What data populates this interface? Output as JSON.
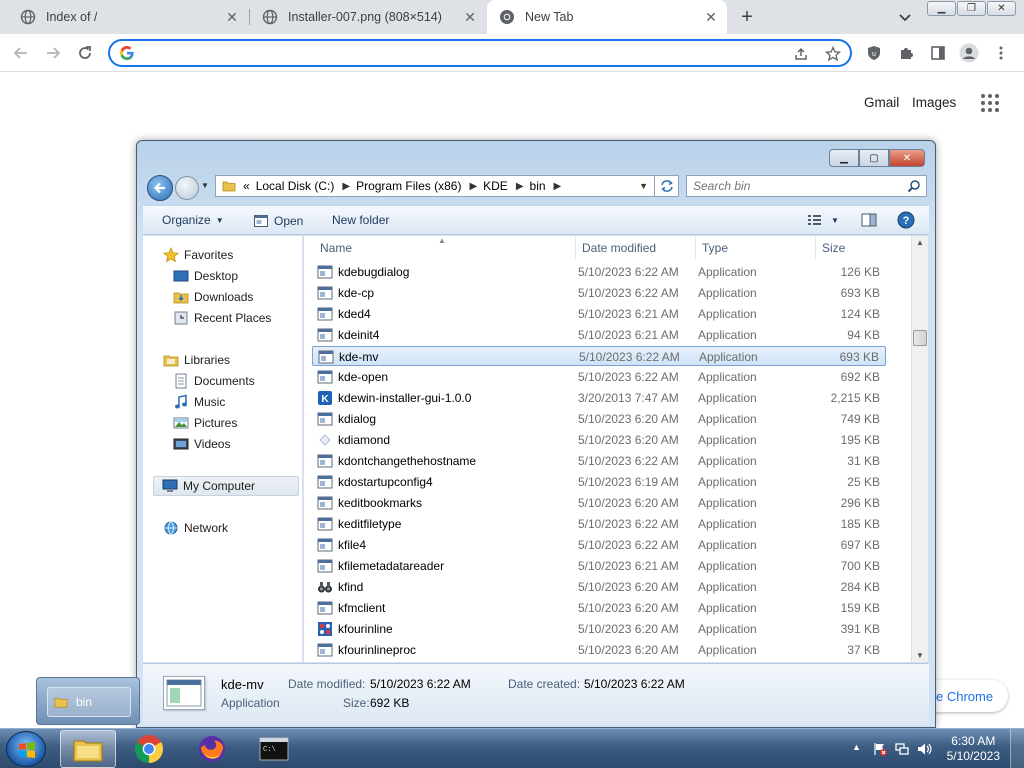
{
  "browser": {
    "tabs": [
      {
        "title": "Index of /",
        "icon": "globe-icon"
      },
      {
        "title": "Installer-007.png (808×514)",
        "icon": "globe-icon"
      },
      {
        "title": "New Tab",
        "icon": "chrome-icon",
        "active": true
      }
    ],
    "omnibox": {
      "value": "",
      "placeholder": ""
    },
    "ntp": {
      "gmail": "Gmail",
      "images": "Images",
      "customize_chip": "e Chrome"
    }
  },
  "explorer": {
    "breadcrumb_prefix": "«",
    "breadcrumb": [
      "Local Disk (C:)",
      "Program Files (x86)",
      "KDE",
      "bin"
    ],
    "search_placeholder": "Search bin",
    "commands": {
      "organize": "Organize",
      "open": "Open",
      "new_folder": "New folder"
    },
    "nav": {
      "favorites": "Favorites",
      "favorites_items": [
        "Desktop",
        "Downloads",
        "Recent Places"
      ],
      "libraries": "Libraries",
      "libraries_items": [
        "Documents",
        "Music",
        "Pictures",
        "Videos"
      ],
      "computer": "My Computer",
      "network": "Network"
    },
    "columns": {
      "name": "Name",
      "date": "Date modified",
      "type": "Type",
      "size": "Size"
    },
    "files": [
      {
        "name": "kdebugdialog",
        "date": "5/10/2023 6:22 AM",
        "type": "Application",
        "size": "126 KB",
        "icon": "app-window"
      },
      {
        "name": "kde-cp",
        "date": "5/10/2023 6:22 AM",
        "type": "Application",
        "size": "693 KB",
        "icon": "app-window"
      },
      {
        "name": "kded4",
        "date": "5/10/2023 6:21 AM",
        "type": "Application",
        "size": "124 KB",
        "icon": "app-window"
      },
      {
        "name": "kdeinit4",
        "date": "5/10/2023 6:21 AM",
        "type": "Application",
        "size": "94 KB",
        "icon": "app-window"
      },
      {
        "name": "kde-mv",
        "date": "5/10/2023 6:22 AM",
        "type": "Application",
        "size": "693 KB",
        "icon": "app-window",
        "selected": true
      },
      {
        "name": "kde-open",
        "date": "5/10/2023 6:22 AM",
        "type": "Application",
        "size": "692 KB",
        "icon": "app-window"
      },
      {
        "name": "kdewin-installer-gui-1.0.0",
        "date": "3/20/2013 7:47 AM",
        "type": "Application",
        "size": "2,215 KB",
        "icon": "kde-logo"
      },
      {
        "name": "kdialog",
        "date": "5/10/2023 6:20 AM",
        "type": "Application",
        "size": "749 KB",
        "icon": "app-window"
      },
      {
        "name": "kdiamond",
        "date": "5/10/2023 6:20 AM",
        "type": "Application",
        "size": "195 KB",
        "icon": "diamond"
      },
      {
        "name": "kdontchangethehostname",
        "date": "5/10/2023 6:22 AM",
        "type": "Application",
        "size": "31 KB",
        "icon": "app-window"
      },
      {
        "name": "kdostartupconfig4",
        "date": "5/10/2023 6:19 AM",
        "type": "Application",
        "size": "25 KB",
        "icon": "app-window"
      },
      {
        "name": "keditbookmarks",
        "date": "5/10/2023 6:20 AM",
        "type": "Application",
        "size": "296 KB",
        "icon": "app-window"
      },
      {
        "name": "keditfiletype",
        "date": "5/10/2023 6:22 AM",
        "type": "Application",
        "size": "185 KB",
        "icon": "app-window"
      },
      {
        "name": "kfile4",
        "date": "5/10/2023 6:22 AM",
        "type": "Application",
        "size": "697 KB",
        "icon": "app-window"
      },
      {
        "name": "kfilemetadatareader",
        "date": "5/10/2023 6:21 AM",
        "type": "Application",
        "size": "700 KB",
        "icon": "app-window"
      },
      {
        "name": "kfind",
        "date": "5/10/2023 6:20 AM",
        "type": "Application",
        "size": "284 KB",
        "icon": "binoculars"
      },
      {
        "name": "kfmclient",
        "date": "5/10/2023 6:20 AM",
        "type": "Application",
        "size": "159 KB",
        "icon": "app-window"
      },
      {
        "name": "kfourinline",
        "date": "5/10/2023 6:20 AM",
        "type": "Application",
        "size": "391 KB",
        "icon": "game-grid"
      },
      {
        "name": "kfourinlineproc",
        "date": "5/10/2023 6:20 AM",
        "type": "Application",
        "size": "37 KB",
        "icon": "app-window"
      }
    ],
    "details": {
      "name": "kde-mv",
      "type": "Application",
      "modified_label": "Date modified:",
      "modified": "5/10/2023 6:22 AM",
      "created_label": "Date created:",
      "created": "5/10/2023 6:22 AM",
      "size_label": "Size:",
      "size": "692 KB"
    }
  },
  "taskbar": {
    "preview_label": "bin",
    "time": "6:30 AM",
    "date": "5/10/2023"
  }
}
